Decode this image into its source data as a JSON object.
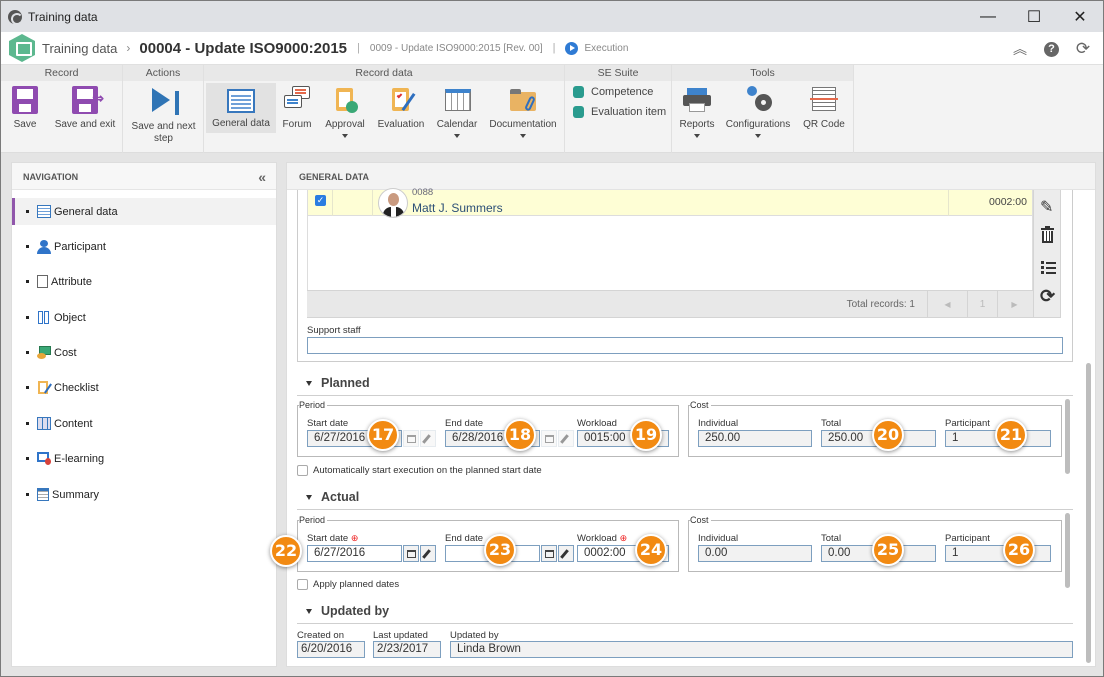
{
  "window": {
    "title": "Training data",
    "controls": {
      "minimize": "—",
      "maximize": "☐",
      "close": "✕"
    }
  },
  "header": {
    "breadcrumb_root": "Training data",
    "breadcrumb_sep": "›",
    "record_title": "00004 - Update ISO9000:2015",
    "sub_record": "0009 - Update ISO9000:2015 [Rev. 00]",
    "status": "Execution",
    "right_icons": [
      "collapse-up-icon",
      "help-icon",
      "refresh-icon"
    ],
    "collapse_glyph": "︽",
    "help_glyph": "?",
    "refresh_glyph": "⟳"
  },
  "ribbon": {
    "groups": {
      "record": "Record",
      "actions": "Actions",
      "record_data": "Record data",
      "se_suite": "SE Suite",
      "tools": "Tools"
    },
    "buttons": {
      "save": "Save",
      "save_exit": "Save and exit",
      "save_next_1": "Save and next",
      "save_next_2": "step",
      "general_data": "General data",
      "forum": "Forum",
      "approval": "Approval",
      "evaluation": "Evaluation",
      "calendar": "Calendar",
      "documentation": "Documentation",
      "competence": "Competence",
      "evaluation_item": "Evaluation item",
      "reports": "Reports",
      "configurations": "Configurations",
      "qr_code": "QR Code"
    }
  },
  "navigation": {
    "title": "NAVIGATION",
    "collapse_glyph": "«",
    "items": [
      {
        "label": "General data",
        "active": true
      },
      {
        "label": "Participant"
      },
      {
        "label": "Attribute"
      },
      {
        "label": "Object"
      },
      {
        "label": "Cost"
      },
      {
        "label": "Checklist"
      },
      {
        "label": "Content"
      },
      {
        "label": "E-learning"
      },
      {
        "label": "Summary"
      }
    ]
  },
  "main": {
    "title": "GENERAL DATA",
    "grid": {
      "row": {
        "checked": true,
        "code": "0088",
        "name": "Matt J. Summers",
        "workload": "0002:00"
      },
      "total_records": "Total records: 1",
      "page": "1",
      "prev_glyph": "◀",
      "next_glyph": "▶",
      "side_tools": [
        "edit-icon",
        "delete-icon",
        "list-icon",
        "refresh-icon"
      ]
    },
    "support_staff": {
      "label": "Support staff",
      "value": ""
    },
    "planned": {
      "title": "Planned",
      "period_legend": "Period",
      "start_date_label": "Start date",
      "start_date": "6/27/2016",
      "end_date_label": "End date",
      "end_date": "6/28/2016",
      "workload_label": "Workload",
      "workload": "0015:00",
      "cost_legend": "Cost",
      "individual_label": "Individual",
      "individual": "250.00",
      "total_label": "Total",
      "total": "250.00",
      "participant_label": "Participant",
      "participant": "1",
      "auto_start_label": "Automatically start execution on the planned start date",
      "auto_start_checked": false
    },
    "actual": {
      "title": "Actual",
      "period_legend": "Period",
      "start_date_label": "Start date",
      "start_date": "6/27/2016",
      "end_date_label": "End date",
      "end_date": "",
      "workload_label": "Workload",
      "workload": "0002:00",
      "required_glyph": "⊕",
      "cost_legend": "Cost",
      "individual_label": "Individual",
      "individual": "0.00",
      "total_label": "Total",
      "total": "0.00",
      "participant_label": "Participant",
      "participant": "1",
      "apply_planned_label": "Apply planned dates",
      "apply_planned_checked": false
    },
    "updated_by": {
      "title": "Updated by",
      "created_on_label": "Created on",
      "created_on": "6/20/2016",
      "last_updated_label": "Last updated",
      "last_updated": "2/23/2017",
      "updated_by_label": "Updated by",
      "updated_by": "Linda Brown"
    },
    "callouts": [
      "17",
      "18",
      "19",
      "20",
      "21",
      "22",
      "23",
      "24",
      "25",
      "26"
    ]
  }
}
